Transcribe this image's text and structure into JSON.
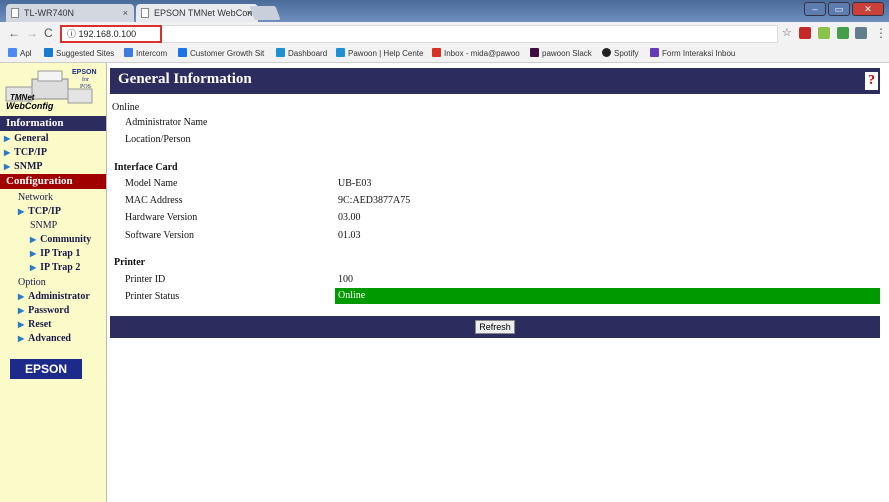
{
  "browser": {
    "tabs": [
      {
        "title": "TL-WR740N",
        "close": "×"
      },
      {
        "title": "EPSON TMNet WebConfi",
        "close": "×"
      }
    ],
    "window_controls": {
      "minimize": "–",
      "maximize": "▭",
      "close": "✕"
    },
    "url": "192.168.0.100",
    "info_glyph": "ⓘ",
    "bookmarks": [
      {
        "label": "Apl",
        "icon_color": "#4a8af4"
      },
      {
        "label": "Suggested Sites",
        "icon_color": "#1a7bd1"
      },
      {
        "label": "Intercom",
        "icon_color": "#3d7be0"
      },
      {
        "label": "Customer Growth Sit",
        "icon_color": "#1a73e8"
      },
      {
        "label": "Dashboard",
        "icon_color": "#1e90d6"
      },
      {
        "label": "Pawoon | Help Cente",
        "icon_color": "#1e90d6"
      },
      {
        "label": "Inbox - mida@pawoo",
        "icon_color": "#d93025"
      },
      {
        "label": "pawoon Slack",
        "icon_color": "#3f0e40"
      },
      {
        "label": "Spotify",
        "icon_color": "#222222"
      },
      {
        "label": "Form Interaksi Inbou",
        "icon_color": "#673ab7"
      }
    ]
  },
  "sidebar": {
    "logo": {
      "brand": "EPSON",
      "line2": "for",
      "line3": "POS",
      "app1": "TMNet",
      "app2": "WebConfig"
    },
    "information_header": "Information",
    "information_items": [
      "General",
      "TCP/IP",
      "SNMP"
    ],
    "configuration_header": "Configuration",
    "network_label": "Network",
    "tcpip": "TCP/IP",
    "snmp_label": "SNMP",
    "snmp_items": [
      "Community",
      "IP Trap 1",
      "IP Trap 2"
    ],
    "option_label": "Option",
    "option_items": [
      "Administrator",
      "Password",
      "Reset",
      "Advanced"
    ],
    "epson_logo": "EPSON",
    "arrow": "▶"
  },
  "main": {
    "title": "General Information",
    "help_icon": "?",
    "online_group": "Online",
    "admin_name_label": "Administrator Name",
    "location_label": "Location/Person",
    "interface_group": "Interface Card",
    "interface_rows": [
      {
        "label": "Model Name",
        "value": "UB-E03"
      },
      {
        "label": "MAC Address",
        "value": "9C:AED3877A75"
      },
      {
        "label": "Hardware Version",
        "value": "03.00"
      },
      {
        "label": "Software Version",
        "value": "01.03"
      }
    ],
    "printer_group": "Printer",
    "printer_id_label": "Printer ID",
    "printer_id_value": "100",
    "printer_status_label": "Printer Status",
    "printer_status_value": "Online",
    "refresh_label": "Refresh"
  },
  "colors": {
    "status_online": "#009900",
    "header_navy": "#2c2c5e",
    "sidebar_bg": "#fbfbc9",
    "config_red": "#a00000"
  }
}
